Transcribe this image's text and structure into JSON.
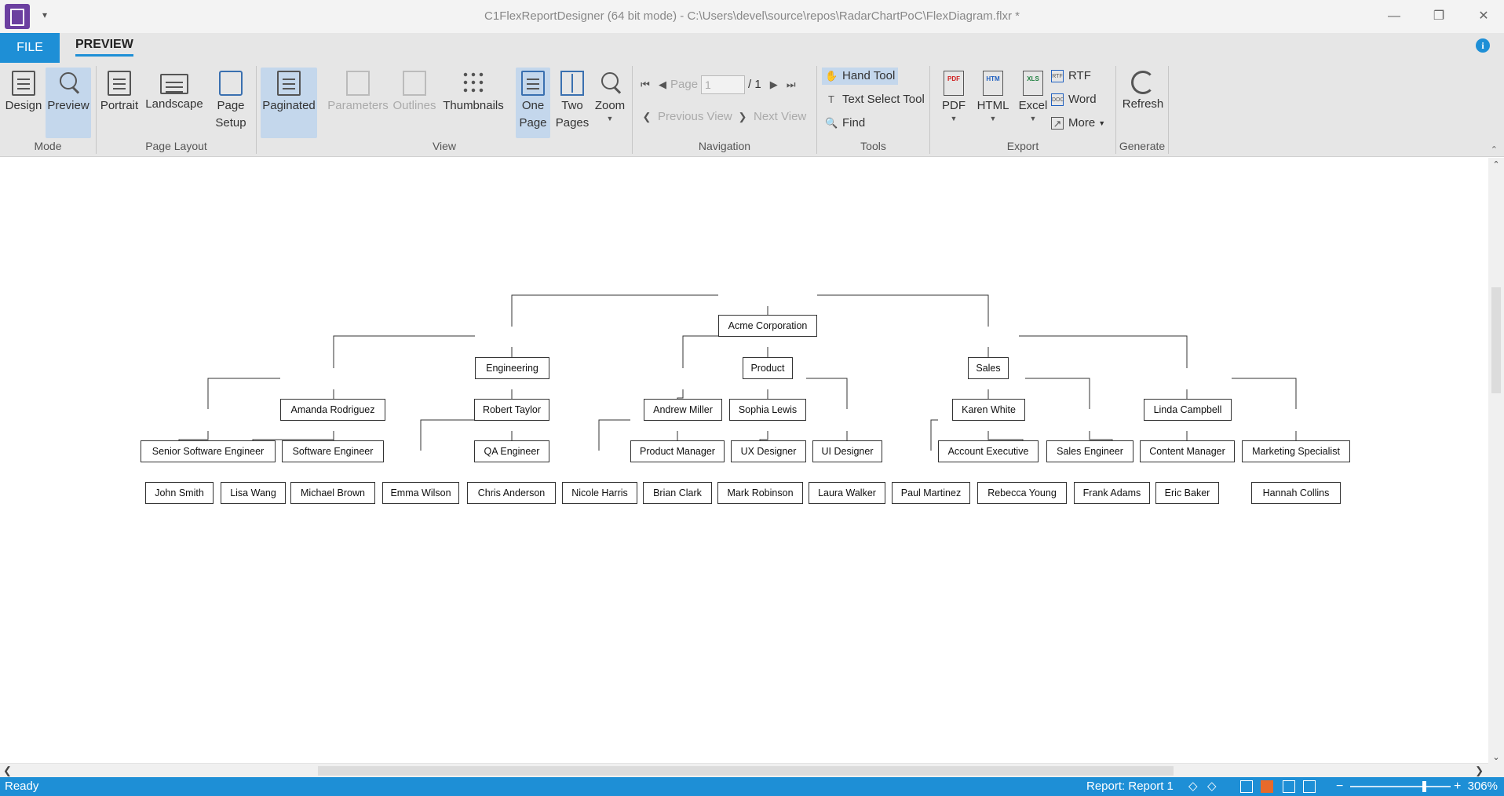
{
  "window": {
    "title": "C1FlexReportDesigner (64 bit mode) - C:\\Users\\devel\\source\\repos\\RadarChartPoC\\FlexDiagram.flxr *"
  },
  "tabs": {
    "file": "FILE",
    "preview": "PREVIEW"
  },
  "ribbon": {
    "mode": {
      "label": "Mode",
      "design": "Design",
      "preview": "Preview"
    },
    "page_layout": {
      "label": "Page Layout",
      "portrait": "Portrait",
      "landscape": "Landscape",
      "page_setup_1": "Page",
      "page_setup_2": "Setup"
    },
    "view": {
      "label": "View",
      "paginated": "Paginated",
      "parameters": "Parameters",
      "outlines": "Outlines",
      "thumbnails": "Thumbnails",
      "one_page_1": "One",
      "one_page_2": "Page",
      "two_pages_1": "Two",
      "two_pages_2": "Pages",
      "zoom": "Zoom"
    },
    "navigation": {
      "label": "Navigation",
      "page_label": "Page",
      "page_value": "1",
      "page_total": "/ 1",
      "previous_view": "Previous View",
      "next_view": "Next View"
    },
    "tools": {
      "label": "Tools",
      "hand_tool": "Hand Tool",
      "text_select": "Text Select Tool",
      "find": "Find"
    },
    "export": {
      "label": "Export",
      "pdf": "PDF",
      "html": "HTML",
      "excel": "Excel",
      "rtf": "RTF",
      "word": "Word",
      "more": "More"
    },
    "generate": {
      "label": "Generate",
      "refresh": "Refresh"
    }
  },
  "org_chart": {
    "root": "Acme Corporation",
    "departments": [
      "Engineering",
      "Product",
      "Sales"
    ],
    "people": {
      "amanda": "Amanda Rodriguez",
      "robert": "Robert Taylor",
      "andrew": "Andrew Miller",
      "sophia": "Sophia Lewis",
      "karen": "Karen White",
      "linda": "Linda Campbell"
    },
    "roles": {
      "sse": "Senior Software Engineer",
      "se": "Software Engineer",
      "qa": "QA Engineer",
      "pm": "Product Manager",
      "ux": "UX Designer",
      "ui": "UI Designer",
      "ae": "Account Executive",
      "sales_eng": "Sales Engineer",
      "cm": "Content Manager",
      "ms": "Marketing Specialist"
    },
    "employees": {
      "john": "John Smith",
      "lisa": "Lisa Wang",
      "michael": "Michael Brown",
      "emma": "Emma Wilson",
      "chris": "Chris Anderson",
      "nicole": "Nicole Harris",
      "brian": "Brian Clark",
      "mark": "Mark Robinson",
      "laura": "Laura Walker",
      "paul": "Paul Martinez",
      "rebecca": "Rebecca Young",
      "frank": "Frank Adams",
      "eric": "Eric Baker",
      "hannah": "Hannah Collins"
    }
  },
  "status": {
    "ready": "Ready",
    "report": "Report: Report 1",
    "zoom": "306%"
  }
}
